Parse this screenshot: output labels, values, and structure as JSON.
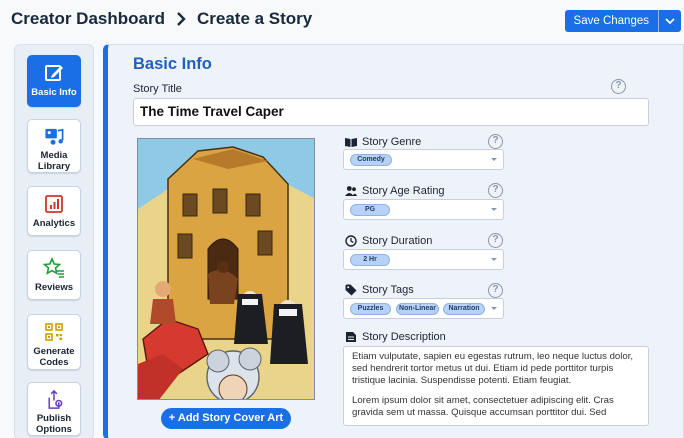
{
  "header": {
    "breadcrumb_root": "Creator Dashboard",
    "breadcrumb_current": "Create a Story",
    "save_label": "Save Changes"
  },
  "sidebar": {
    "items": [
      {
        "label": "Basic Info",
        "icon": "edit-icon",
        "active": true
      },
      {
        "label": "Media Library",
        "icon": "media-library-icon",
        "active": false
      },
      {
        "label": "Analytics",
        "icon": "analytics-icon",
        "active": false
      },
      {
        "label": "Reviews",
        "icon": "star-list-icon",
        "active": false
      },
      {
        "label": "Generate Codes",
        "icon": "qr-code-icon",
        "active": false
      },
      {
        "label": "Publish Options",
        "icon": "publish-gear-icon",
        "active": false
      }
    ]
  },
  "basic_info": {
    "title": "Basic Info",
    "story_title_label": "Story Title",
    "story_title_value": "The Time Travel Caper",
    "cover_button": "+ Add Story Cover Art",
    "genre": {
      "label": "Story Genre",
      "value": "Comedy"
    },
    "age_rating": {
      "label": "Story Age Rating",
      "value": "PG"
    },
    "duration": {
      "label": "Story Duration",
      "value": "2 Hr"
    },
    "tags": {
      "label": "Story Tags",
      "values": [
        "Puzzles",
        "Non-Linear",
        "Narration"
      ]
    },
    "description": {
      "label": "Story Description",
      "paragraphs": [
        "Etiam vulputate, sapien eu egestas rutrum, leo neque luctus dolor, sed hendrerit tortor metus ut dui. Etiam id pede porttitor turpis tristique lacinia. Suspendisse potenti. Etiam feugiat.",
        "Lorem ipsum dolor sit amet, consectetuer adipiscing elit. Cras gravida sem ut massa. Quisque accumsan porttitor dui. Sed"
      ]
    },
    "help_glyph": "?"
  },
  "colors": {
    "accent": "#1a6fe6",
    "title_blue": "#1f5fbf",
    "chip_bg": "#b7d2f4"
  }
}
